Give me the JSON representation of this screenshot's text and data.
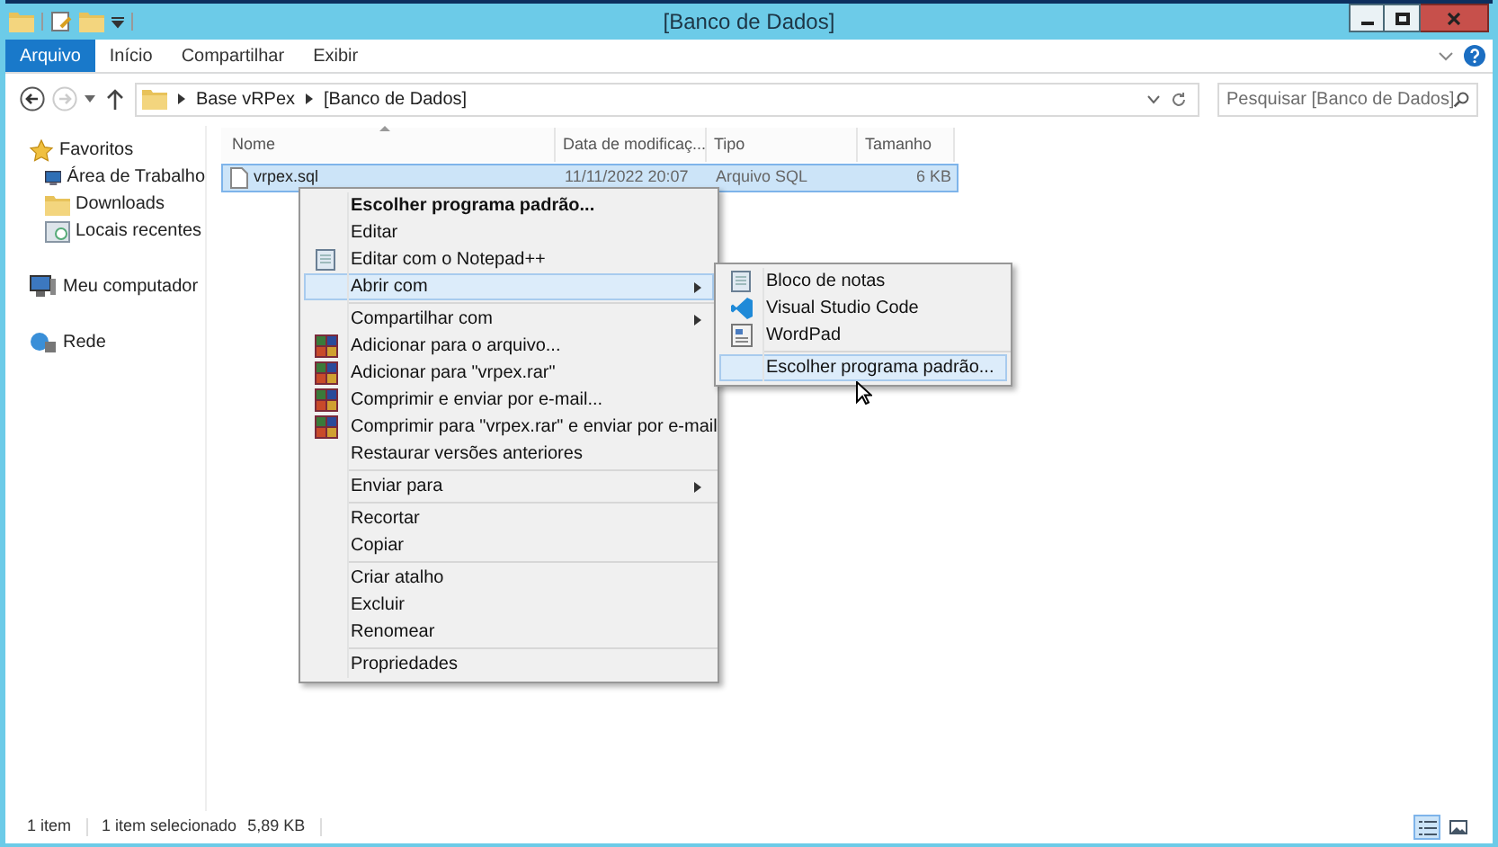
{
  "window": {
    "title": "[Banco de Dados]"
  },
  "ribbon": {
    "tabs": [
      {
        "label": "Arquivo",
        "selected": true
      },
      {
        "label": "Início",
        "selected": false
      },
      {
        "label": "Compartilhar",
        "selected": false
      },
      {
        "label": "Exibir",
        "selected": false
      }
    ]
  },
  "address": {
    "crumbs": [
      "Base vRPex",
      "[Banco de Dados]"
    ]
  },
  "search": {
    "placeholder": "Pesquisar [Banco de Dados]"
  },
  "sidebar": {
    "items": [
      {
        "label": "Favoritos",
        "kind": "star",
        "children": [
          {
            "label": "Área de Trabalho",
            "kind": "desktop"
          },
          {
            "label": "Downloads",
            "kind": "folder"
          },
          {
            "label": "Locais recentes",
            "kind": "recent"
          }
        ]
      },
      {
        "label": "Meu computador",
        "kind": "computer"
      },
      {
        "label": "Rede",
        "kind": "network"
      }
    ]
  },
  "table": {
    "columns": [
      "Nome",
      "Data de modificaç...",
      "Tipo",
      "Tamanho"
    ],
    "rows": [
      {
        "cells": [
          "vrpex.sql",
          "11/11/2022 20:07",
          "Arquivo SQL",
          "6 KB"
        ],
        "selected": true
      }
    ]
  },
  "context_menu": {
    "groups": [
      [
        {
          "label": "Escolher programa padrão...",
          "kind": "plain",
          "default": true,
          "submenu": false,
          "selected": false
        },
        {
          "label": "Editar",
          "kind": "plain",
          "default": false,
          "submenu": false,
          "selected": false
        },
        {
          "label": "Editar com o Notepad++",
          "kind": "notepad",
          "default": false,
          "submenu": false,
          "selected": false
        },
        {
          "label": "Abrir com",
          "kind": "plain",
          "default": false,
          "submenu": true,
          "selected": true
        }
      ],
      [
        {
          "label": "Compartilhar com",
          "kind": "plain",
          "default": false,
          "submenu": true,
          "selected": false
        },
        {
          "label": "Adicionar para o arquivo...",
          "kind": "archive",
          "default": false,
          "submenu": false,
          "selected": false
        },
        {
          "label": "Adicionar para \"vrpex.rar\"",
          "kind": "archive",
          "default": false,
          "submenu": false,
          "selected": false
        },
        {
          "label": "Comprimir e enviar por e-mail...",
          "kind": "archive",
          "default": false,
          "submenu": false,
          "selected": false
        },
        {
          "label": "Comprimir para \"vrpex.rar\" e enviar por e-mail",
          "kind": "archive",
          "default": false,
          "submenu": false,
          "selected": false
        },
        {
          "label": "Restaurar versões anteriores",
          "kind": "plain",
          "default": false,
          "submenu": false,
          "selected": false
        }
      ],
      [
        {
          "label": "Enviar para",
          "kind": "plain",
          "default": false,
          "submenu": true,
          "selected": false
        }
      ],
      [
        {
          "label": "Recortar",
          "kind": "plain",
          "default": false,
          "submenu": false,
          "selected": false
        },
        {
          "label": "Copiar",
          "kind": "plain",
          "default": false,
          "submenu": false,
          "selected": false
        }
      ],
      [
        {
          "label": "Criar atalho",
          "kind": "plain",
          "default": false,
          "submenu": false,
          "selected": false
        },
        {
          "label": "Excluir",
          "kind": "plain",
          "default": false,
          "submenu": false,
          "selected": false
        },
        {
          "label": "Renomear",
          "kind": "plain",
          "default": false,
          "submenu": false,
          "selected": false
        }
      ],
      [
        {
          "label": "Propriedades",
          "kind": "plain",
          "default": false,
          "submenu": false,
          "selected": false
        }
      ]
    ]
  },
  "submenu": {
    "groups": [
      [
        {
          "label": "Bloco de notas",
          "kind": "notepad",
          "selected": false
        },
        {
          "label": "Visual Studio Code",
          "kind": "vscode",
          "selected": false
        },
        {
          "label": "WordPad",
          "kind": "wordpad",
          "selected": false
        }
      ],
      [
        {
          "label": "Escolher programa padrão...",
          "kind": "plain",
          "selected": true
        }
      ]
    ]
  },
  "status_bar": {
    "count": "1 item",
    "selection": "1 item selecionado",
    "size": "5,89 KB",
    "views": [
      {
        "kind": "details",
        "selected": true
      },
      {
        "kind": "thumbnails",
        "selected": false
      }
    ]
  }
}
